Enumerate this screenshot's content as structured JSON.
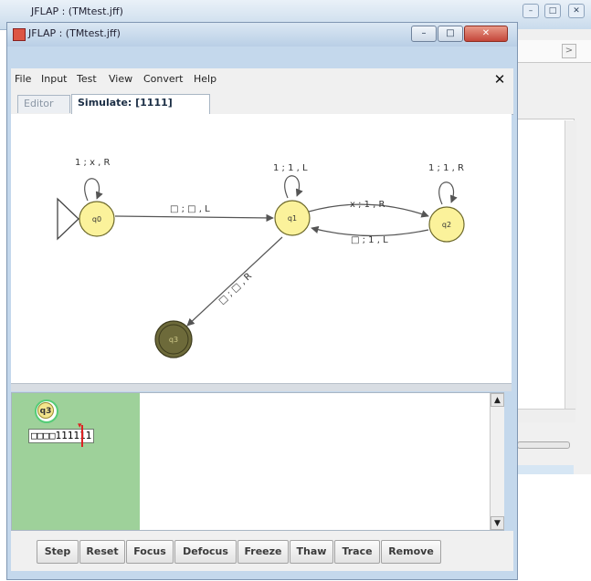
{
  "background_window": {
    "title": "JFLAP : (TMtest.jff)",
    "tab_arrow": ">",
    "controls": [
      "–",
      "□",
      "✕"
    ]
  },
  "window": {
    "title": "JFLAP : (TMtest.jff)",
    "minimize_symbol": "–",
    "maximize_symbol": "□",
    "close_symbol": "✕"
  },
  "menu": {
    "items": [
      "File",
      "Input",
      "Test",
      "View",
      "Convert",
      "Help"
    ],
    "close_label": "✕"
  },
  "tabs": {
    "editor": "Editor",
    "simulate": "Simulate: [1111]"
  },
  "diagram": {
    "states": [
      {
        "id": "q0",
        "initial": true,
        "final": false
      },
      {
        "id": "q1",
        "initial": false,
        "final": false
      },
      {
        "id": "q2",
        "initial": false,
        "final": false
      },
      {
        "id": "q3",
        "initial": false,
        "final": true
      }
    ],
    "transitions": [
      {
        "from": "q0",
        "to": "q0",
        "label": "1 ; x , R"
      },
      {
        "from": "q0",
        "to": "q1",
        "label": "□ ; □ , L"
      },
      {
        "from": "q1",
        "to": "q1",
        "label": "1 ; 1 , L"
      },
      {
        "from": "q1",
        "to": "q2",
        "label": "x ; 1 , R"
      },
      {
        "from": "q2",
        "to": "q1",
        "label": "□ ; 1 , L"
      },
      {
        "from": "q2",
        "to": "q2",
        "label": "1 ; 1 , R"
      },
      {
        "from": "q1",
        "to": "q3",
        "label": "□ ; □ , R"
      }
    ],
    "colors": {
      "state_fill": "#fbf29b",
      "state_stroke": "#6e6a2c",
      "final_fill": "#6d6a3a",
      "edge": "#555555"
    }
  },
  "configuration": {
    "state": "q3",
    "tape": "□□□□111111",
    "colors": {
      "card": "#9ed19a",
      "head": "#dd2222"
    }
  },
  "buttons": [
    "Step",
    "Reset",
    "Focus",
    "Defocus",
    "Freeze",
    "Thaw",
    "Trace",
    "Remove"
  ]
}
